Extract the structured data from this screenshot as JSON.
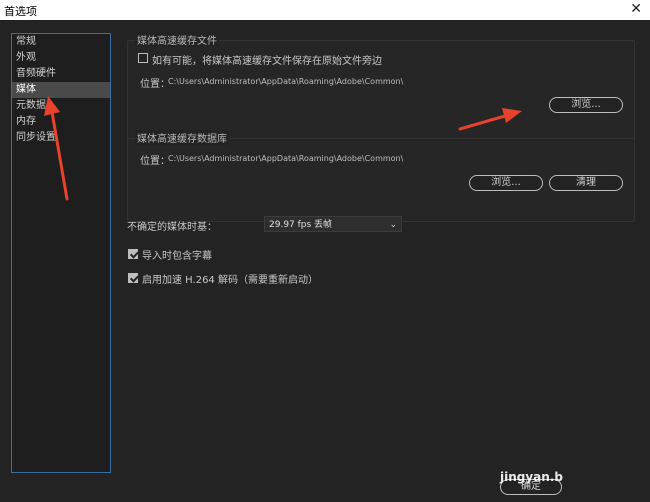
{
  "window": {
    "title": "首选项",
    "close_glyph": "✕"
  },
  "sidebar": {
    "items": [
      {
        "label": "常规"
      },
      {
        "label": "外观"
      },
      {
        "label": "音频硬件"
      },
      {
        "label": "媒体",
        "active": true
      },
      {
        "label": "元数据"
      },
      {
        "label": "内存"
      },
      {
        "label": "同步设置"
      }
    ]
  },
  "media_cache_files": {
    "title": "媒体高速缓存文件",
    "checkbox_label": "如有可能，将媒体高速缓存文件保存在原始文件旁边",
    "checked": false,
    "location_label": "位置：",
    "location_path": "C:\\Users\\Administrator\\AppData\\Roaming\\Adobe\\Common\\",
    "browse_label": "浏览..."
  },
  "media_cache_db": {
    "title": "媒体高速缓存数据库",
    "location_label": "位置：",
    "location_path": "C:\\Users\\Administrator\\AppData\\Roaming\\Adobe\\Common\\",
    "browse_label": "浏览...",
    "clean_label": "清理"
  },
  "timebase": {
    "label": "不确定的媒体时基：",
    "value": "29.97 fps 丢帧"
  },
  "options": {
    "include_captions": {
      "label": "导入时包含字幕",
      "checked": true
    },
    "h264_accel": {
      "label": "启用加速 H.264 解码（需要重新启动）",
      "checked": true
    }
  },
  "footer": {
    "ok_label": "确定",
    "watermark": "jingyan.b"
  },
  "colors": {
    "background": "#232323",
    "annotation_arrow": "#e8412c",
    "sidebar_border": "#3a6ea5"
  },
  "icons": {
    "close": "close-icon",
    "dropdown": "chevron-down-icon",
    "annotation": "red-arrow-annotation"
  }
}
